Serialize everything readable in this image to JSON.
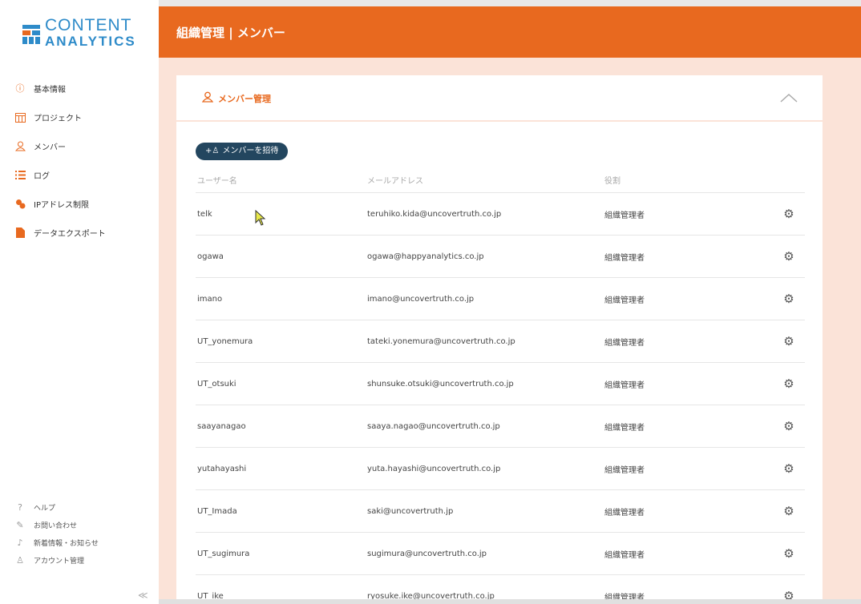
{
  "brand": {
    "line1": "CONTENT",
    "line2": "ANALYTICS"
  },
  "header": {
    "title": "組織管理 | メンバー"
  },
  "sidebar": {
    "items": [
      {
        "label": "基本情報",
        "icon": "info-icon"
      },
      {
        "label": "プロジェクト",
        "icon": "calendar-icon"
      },
      {
        "label": "メンバー",
        "icon": "members-icon"
      },
      {
        "label": "ログ",
        "icon": "list-icon"
      },
      {
        "label": "IPアドレス制限",
        "icon": "ip-restriction-icon"
      },
      {
        "label": "データエクスポート",
        "icon": "export-icon"
      }
    ],
    "bottom_items": [
      {
        "label": "ヘルプ",
        "icon": "help-icon"
      },
      {
        "label": "お問い合わせ",
        "icon": "contact-icon"
      },
      {
        "label": "新着情報・お知らせ",
        "icon": "bell-icon"
      },
      {
        "label": "アカウント管理",
        "icon": "account-icon"
      }
    ],
    "collapse_label": "≪"
  },
  "card": {
    "title": "メンバー管理",
    "invite_label": "メンバーを招待"
  },
  "table": {
    "headers": [
      "ユーザー名",
      "メールアドレス",
      "役割"
    ],
    "rows": [
      {
        "user": "telk",
        "email": "teruhiko.kida@uncovertruth.co.jp",
        "role": "組織管理者"
      },
      {
        "user": "ogawa",
        "email": "ogawa@happyanalytics.co.jp",
        "role": "組織管理者"
      },
      {
        "user": "imano",
        "email": "imano@uncovertruth.co.jp",
        "role": "組織管理者"
      },
      {
        "user": "UT_yonemura",
        "email": "tateki.yonemura@uncovertruth.co.jp",
        "role": "組織管理者"
      },
      {
        "user": "UT_otsuki",
        "email": "shunsuke.otsuki@uncovertruth.co.jp",
        "role": "組織管理者"
      },
      {
        "user": "saayanagao",
        "email": "saaya.nagao@uncovertruth.co.jp",
        "role": "組織管理者"
      },
      {
        "user": "yutahayashi",
        "email": "yuta.hayashi@uncovertruth.co.jp",
        "role": "組織管理者"
      },
      {
        "user": "UT_Imada",
        "email": "saki@uncovertruth.jp",
        "role": "組織管理者"
      },
      {
        "user": "UT_sugimura",
        "email": "sugimura@uncovertruth.co.jp",
        "role": "組織管理者"
      },
      {
        "user": "UT_ike",
        "email": "ryosuke.ike@uncovertruth.co.jp",
        "role": "組織管理者"
      }
    ]
  },
  "colors": {
    "accent": "#e8691f",
    "brand": "#2e8bc9",
    "button": "#23465f",
    "background": "#fbe3d8"
  }
}
